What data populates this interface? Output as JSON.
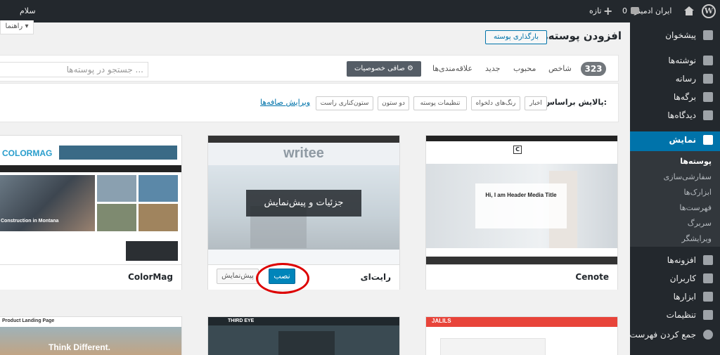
{
  "adminbar": {
    "site_name": "ایران ادمینز",
    "comments_count": "0",
    "new_label": "تازه",
    "greeting": "سلام"
  },
  "sidebar": {
    "items": [
      {
        "label": "پیشخوان"
      },
      {
        "label": "نوشته‌ها"
      },
      {
        "label": "رسانه"
      },
      {
        "label": "برگه‌ها"
      },
      {
        "label": "دیدگاه‌ها"
      },
      {
        "label": "نمایش"
      },
      {
        "label": "افزونه‌ها"
      },
      {
        "label": "کاربران"
      },
      {
        "label": "ابزارها"
      },
      {
        "label": "تنظیمات"
      },
      {
        "label": "جمع کردن فهرست"
      }
    ],
    "submenu": [
      "پوسته‌ها",
      "سفارشی‌سازی",
      "ابزارک‌ها",
      "فهرست‌ها",
      "سربرگ",
      "ویرایشگر"
    ]
  },
  "help": {
    "label": "راهنما"
  },
  "header": {
    "title": "افزودن پوسته‌ها",
    "upload_label": "بارگذاری پوسته"
  },
  "filter_bar": {
    "count": "323",
    "tabs": [
      "شاخص",
      "محبوب",
      "جدید",
      "علاقه‌مندی‌ها"
    ],
    "feature_filter": "صافی خصوصیات",
    "search_placeholder": "جستجو در پوسته‌ها ..."
  },
  "subfilter": {
    "label": "پالایش براساس:",
    "pills": [
      "اخبار",
      "رنگ‌های دلخواه",
      "تنظیمات پوسته",
      "دو ستون",
      "ستون‌کناری راست"
    ],
    "edit_label": "ویرایش صافه‌ها"
  },
  "themes": [
    {
      "name": "Cenote",
      "banner": "Hi, I am Header Media Title"
    },
    {
      "name": "رایت‌ای",
      "logo": "writee",
      "overlay": "جزئیات و پیش‌نمایش",
      "install": "نصب",
      "preview": "پیش‌نمایش"
    },
    {
      "name": "ColorMag",
      "logo": "COLORMAG",
      "headline": "Construction in Montana"
    }
  ],
  "bottom_themes": [
    {
      "header": "JALILS"
    },
    {
      "header": "THIRD EYE"
    },
    {
      "header": "Product Landing Page",
      "tagline": "Think Different."
    }
  ]
}
